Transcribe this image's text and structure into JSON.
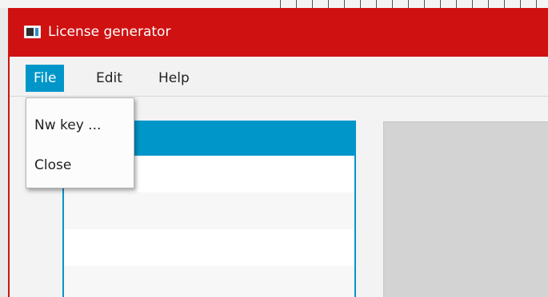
{
  "window": {
    "title": "License generator",
    "app_icon": "application-window-icon"
  },
  "menubar": {
    "items": [
      {
        "label": "File",
        "active": true
      },
      {
        "label": "Edit",
        "active": false
      },
      {
        "label": "Help",
        "active": false
      }
    ]
  },
  "file_menu": {
    "items": [
      {
        "label": "Nw key ..."
      },
      {
        "label": "Close"
      }
    ]
  },
  "list": {
    "rows": [
      {
        "selected": true
      },
      {
        "selected": false
      },
      {
        "selected": false
      },
      {
        "selected": false
      },
      {
        "selected": false
      }
    ]
  },
  "colors": {
    "titlebar": "#cf1111",
    "accent": "#0096c9",
    "menubar": "#f2f2f2",
    "right_panel": "#d3d3d3"
  }
}
